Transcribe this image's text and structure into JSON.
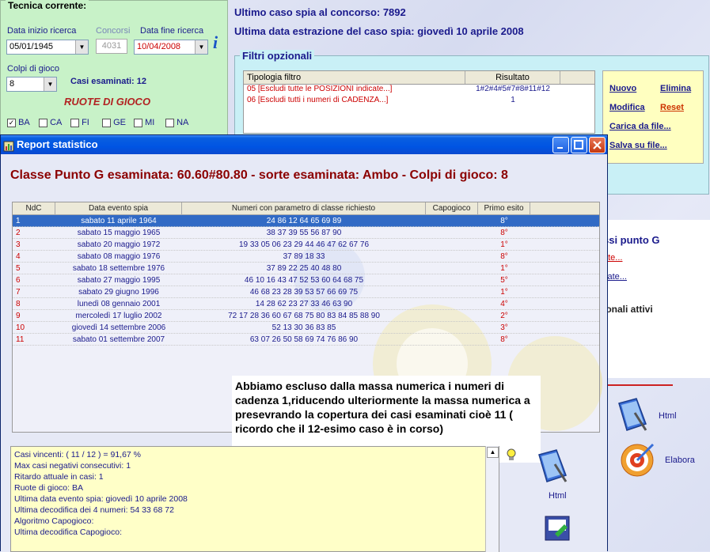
{
  "app": {
    "current_technique_legend": "Tecnica corrente:",
    "start_date_label": "Data inizio ricerca",
    "start_date_value": "05/01/1945",
    "contests_label": "Concorsi",
    "contests_value": "4031",
    "end_date_label": "Data fine ricerca",
    "end_date_value": "10/04/2008",
    "plays_label": "Colpi di gioco",
    "plays_value": "8",
    "cases_examined": "Casi esaminati: 12",
    "wheels_title": "RUOTE  DI  GIOCO",
    "wheels": [
      {
        "label": "BA",
        "checked": true
      },
      {
        "label": "CA",
        "checked": false
      },
      {
        "label": "FI",
        "checked": false
      },
      {
        "label": "GE",
        "checked": false
      },
      {
        "label": "MI",
        "checked": false
      },
      {
        "label": "NA",
        "checked": false
      }
    ],
    "last_spy_case": "Ultimo caso spia al concorso:  7892",
    "last_draw_date": "Ultima data estrazione del caso spia:  giovedì 10 aprile 2008",
    "filters_legend": "Filtri opzionali",
    "filter_headers": [
      "Tipologia filtro",
      "Risultato"
    ],
    "filter_rows": [
      {
        "type": "05 [Escludi tutte le POSIZIONI indicate...]",
        "result": "1#2#4#5#7#8#11#12"
      },
      {
        "type": "06 [Escludi tutti i numeri di CADENZA...]",
        "result": "1"
      }
    ],
    "filter_actions": {
      "new": "Nuovo",
      "delete": "Elimina",
      "edit": "Modifica",
      "reset": "Reset",
      "load": "Carica da file...",
      "save": "Salva su file..."
    },
    "right_panel": {
      "class_title": "ssi punto G",
      "link1": "ate...",
      "link2": "zate...",
      "active": "ionali attivi"
    },
    "html_label": "Html",
    "elabora_label": "Elabora"
  },
  "report": {
    "window_title": "Report statistico",
    "heading": "Classe Punto G esaminata: 60.60#80.80 - sorte esaminata: Ambo - Colpi di gioco: 8",
    "headers": [
      "NdC",
      "Data evento spia",
      "Numeri con parametro di classe richiesto",
      "Capogioco",
      "Primo esito"
    ],
    "rows": [
      [
        "1",
        "sabato 11 aprile 1964",
        "24 86 12 64 65 69 89",
        "",
        "8°"
      ],
      [
        "2",
        "sabato 15 maggio 1965",
        "38 37 39 55 56 87 90",
        "",
        "8°"
      ],
      [
        "3",
        "sabato 20 maggio 1972",
        "19 33 05 06 23 29 44 46 47 62 67 76",
        "",
        "1°"
      ],
      [
        "4",
        "sabato 08 maggio 1976",
        "37 89 18 33",
        "",
        "8°"
      ],
      [
        "5",
        "sabato 18 settembre 1976",
        "37 89 22 25 40 48 80",
        "",
        "1°"
      ],
      [
        "6",
        "sabato 27 maggio 1995",
        "46 10 16 43 47 52 53 60 64 68 75",
        "",
        "5°"
      ],
      [
        "7",
        "sabato 29 giugno 1996",
        "46 68 23 28 39 53 57 66 69 75",
        "",
        "1°"
      ],
      [
        "8",
        "lunedì 08 gennaio 2001",
        "14 28 62 23 27 33 46 63 90",
        "",
        "4°"
      ],
      [
        "9",
        "mercoledì 17 luglio 2002",
        "72 17 28 36 60 67 68 75 80 83 84 85 88 90",
        "",
        "2°"
      ],
      [
        "10",
        "giovedì 14 settembre 2006",
        "52 13 30 36 83 85",
        "",
        "3°"
      ],
      [
        "11",
        "sabato 01 settembre 2007",
        "63 07 26 50 58 69 74 76 86 90",
        "",
        "8°"
      ]
    ],
    "annotation": "Abbiamo escluso dalla massa numerica i numeri di cadenza 1,riducendo ulteriormente la massa numerica a presevrando la copertura dei casi esaminati cioè 11 ( ricordo che il 12-esimo caso è in corso)",
    "stats": [
      "Casi vincenti: ( 11 / 12 ) = 91,67 %",
      "Max casi negativi consecutivi: 1",
      "Ritardo attuale in casi: 1",
      "Ruote di gioco: BA",
      "Ultima data evento spia: giovedì 10 aprile 2008",
      "Ultima decodifica dei 4 numeri: 54 33 68 72",
      "Algoritmo Capogioco:",
      "Ultima decodifica Capogioco:"
    ],
    "html_label": "Html"
  }
}
